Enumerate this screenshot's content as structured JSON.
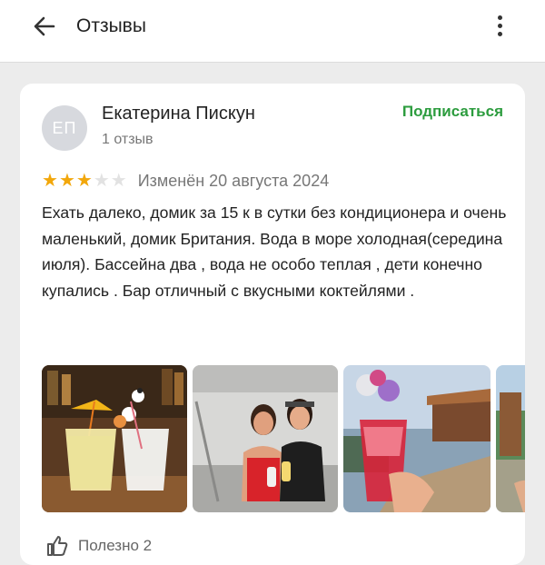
{
  "header": {
    "title": "Отзывы"
  },
  "review": {
    "avatar_initials": "ЕП",
    "author": "Екатерина Пискун",
    "review_count": "1 отзыв",
    "subscribe_label": "Подписаться",
    "rating": 3,
    "rating_max": 5,
    "modified": "Изменён 20 августа 2024",
    "text": "Ехать далеко, домик за 15 к в сутки без кондиционера и очень маленький, домик Британия. Вода в море холодная(середина июля). Бассейна два , вода не особо теплая , дети конечно купались . Бар отличный с вкусными коктейлями .",
    "helpful_label": "Полезно 2"
  },
  "colors": {
    "star_on": "#f2a70b",
    "star_off": "#e2e2e2",
    "accent": "#2c9c3e"
  },
  "icons": [
    "back-arrow-icon",
    "more-vert-icon",
    "thumb-up-icon"
  ]
}
